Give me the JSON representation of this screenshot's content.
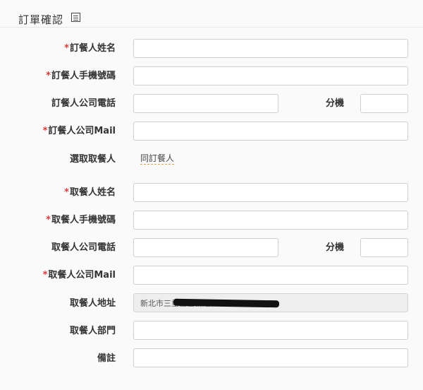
{
  "header": {
    "title": "訂單確認",
    "icon": "list-icon"
  },
  "colors": {
    "required": "#d93a3a",
    "link_underline": "#e3a24a"
  },
  "required_marker": "*",
  "form": {
    "orderer_name_label": "訂餐人姓名",
    "orderer_mobile_label": "訂餐人手機號碼",
    "orderer_phone_label": "訂餐人公司電話",
    "orderer_ext_label": "分機",
    "orderer_mail_label": "訂餐人公司Mail",
    "pickup_select_label": "選取取餐人",
    "same_as_orderer": "同訂餐人",
    "pickup_name_label": "取餐人姓名",
    "pickup_mobile_label": "取餐人手機號碼",
    "pickup_phone_label": "取餐人公司電話",
    "pickup_ext_label": "分機",
    "pickup_mail_label": "取餐人公司Mail",
    "pickup_address_label": "取餐人地址",
    "pickup_address_value": "新北市三重區重新路",
    "pickup_dept_label": "取餐人部門",
    "remarks_label": "備註"
  }
}
